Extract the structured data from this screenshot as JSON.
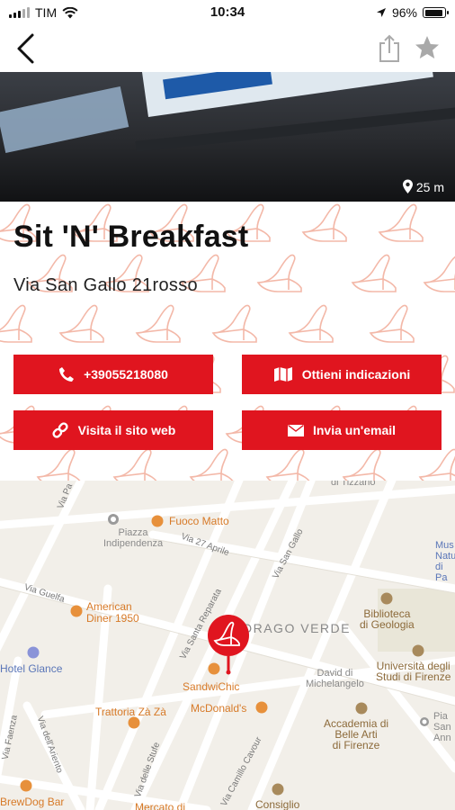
{
  "status_bar": {
    "carrier": "TIM",
    "time": "10:34",
    "battery": "96%"
  },
  "hero": {
    "distance": "25 m"
  },
  "place": {
    "name": "Sit 'N' Breakfast",
    "address": "Via San Gallo 21rosso"
  },
  "actions": {
    "phone": "+39055218080",
    "directions": "Ottieni indicazioni",
    "website": "Visita il sito web",
    "email": "Invia un'email"
  },
  "map": {
    "labels": {
      "piazza": "Piazza\nIndipendenza",
      "fuoco_matto": "Fuoco Matto",
      "american_diner": "American\nDiner 1950",
      "hotel_glance": "Hotel Glance",
      "sandwichic": "SandwiChic",
      "mcdonalds": "McDonald's",
      "trattoria": "Trattoria Zà Zà",
      "brewdog": "BrewDog Bar",
      "mercato": "Mercato di",
      "drago_verde": "DRAGO VERDE",
      "biblioteca": "Biblioteca\ndi Geologia",
      "universita": "Università degli\nStudi di Firenze",
      "david": "David di\nMichelangelo",
      "accademia": "Accademia di\nBelle Arti\ndi Firenze",
      "consiglio": "Consiglio",
      "musei": "Mus\nNatu\ndi\nPa",
      "sanni": "Pia\nSan\nAnn",
      "tizzano": "di Tizzano"
    },
    "streets": {
      "via_27_aprile": "Via 27 Aprile",
      "via_san_gallo": "Via San Gallo",
      "via_guelfa": "Via Guelfa",
      "via_santa_reparata": "Via Santa Reparata",
      "via_faenza": "Via Faenza",
      "via_dell_ariento": "Via dell'Ariento",
      "via_delle_stufe": "Via delle Stufe",
      "via_cavour": "Via Camillo Cavour",
      "via_pa": "Via Pa"
    }
  },
  "colors": {
    "brand_red": "#e0151f",
    "pattern_red": "#f1b3a5"
  },
  "icons": {
    "back": "chevron-left-icon",
    "share": "share-icon",
    "favorite": "star-icon",
    "location": "location-pin-icon",
    "phone": "phone-icon",
    "map": "map-icon",
    "link": "link-icon",
    "mail": "mail-icon"
  }
}
